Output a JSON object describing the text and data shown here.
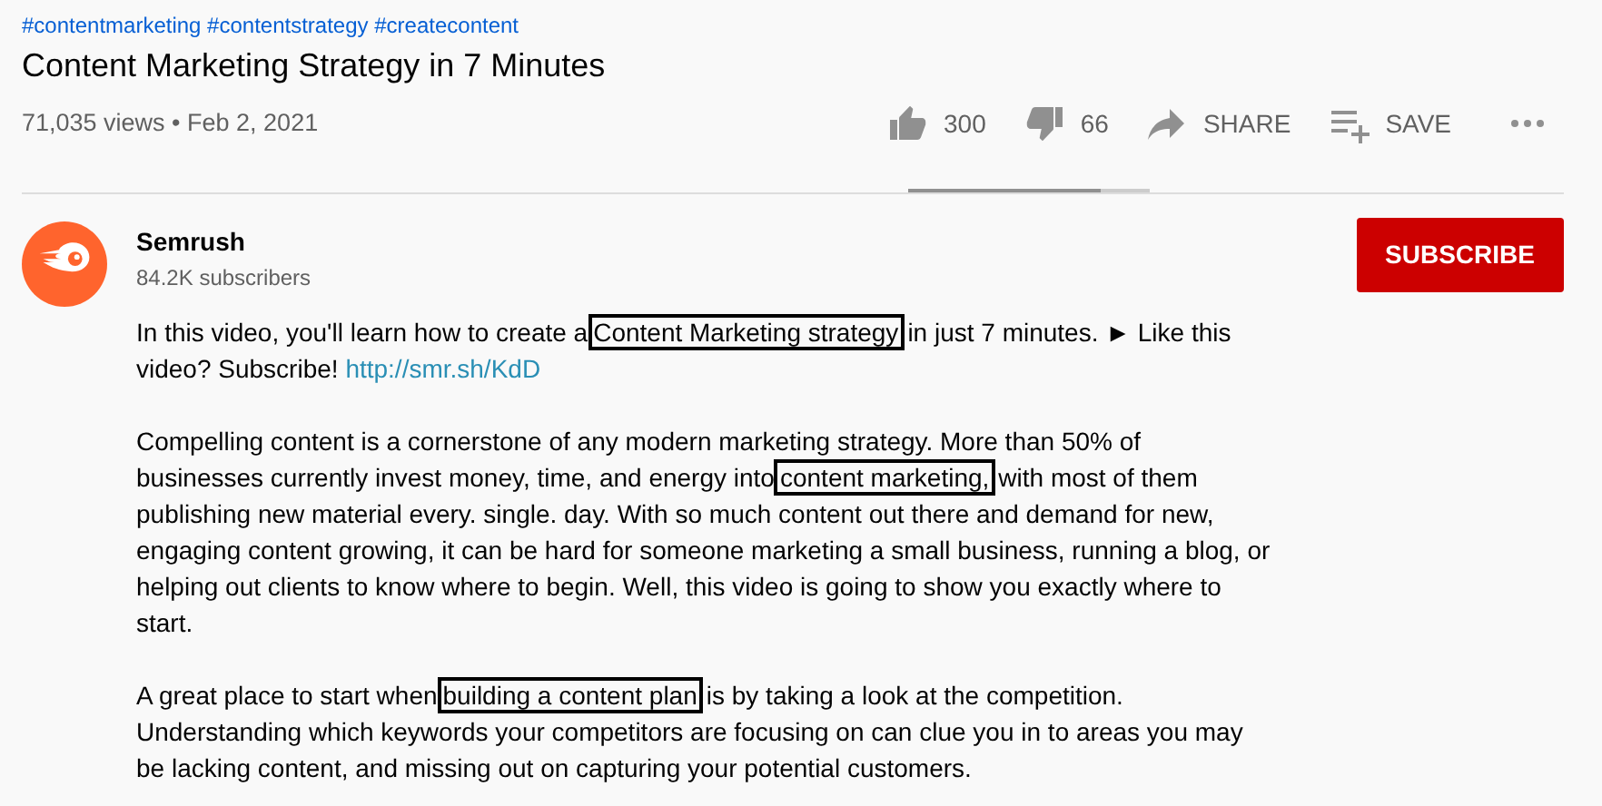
{
  "hashtags": "#contentmarketing #contentstrategy #createcontent",
  "title": "Content Marketing Strategy in 7 Minutes",
  "meta": "71,035 views • Feb 2, 2021",
  "actions": [
    {
      "kind": "like",
      "label": "300"
    },
    {
      "kind": "dislike",
      "label": "66"
    },
    {
      "kind": "share",
      "label": "SHARE"
    },
    {
      "kind": "save",
      "label": "SAVE"
    },
    {
      "kind": "more"
    }
  ],
  "sentiment": {
    "level": 0.8
  },
  "channel": {
    "name": "Semrush",
    "subscribers": "84.2K subscribers",
    "button": "SUBSCRIBE"
  },
  "description": [
    [
      {
        "kind": "text",
        "text": "In this video, you'll learn how to create a"
      },
      {
        "kind": "boxed",
        "text": "Content Marketing strategy"
      },
      {
        "kind": "text",
        "text": "in just 7 minutes. ► Like this video? Subscribe! "
      },
      {
        "kind": "link",
        "text": "http://smr.sh/KdD"
      }
    ],
    [
      {
        "kind": "text",
        "text": "Compelling content is a cornerstone of any modern marketing strategy. More than 50% of businesses currently invest money, time, and energy into"
      },
      {
        "kind": "boxed",
        "text": "content marketing,"
      },
      {
        "kind": "text",
        "text": "with most of them publishing new material every. single. day. With so much content out there and demand for new, engaging content growing, it can be hard for someone marketing a small business, running a blog, or helping out clients to know where to begin. Well, this video is going to show you exactly where to start."
      }
    ],
    [
      {
        "kind": "text",
        "text": "A great place to start when"
      },
      {
        "kind": "boxed",
        "text": "building a content plan"
      },
      {
        "kind": "text",
        "text": "is by taking a look at the competition. Understanding which keywords your competitors are focusing on can clue you in to areas you may be lacking content, and missing out on capturing your potential customers."
      }
    ]
  ]
}
